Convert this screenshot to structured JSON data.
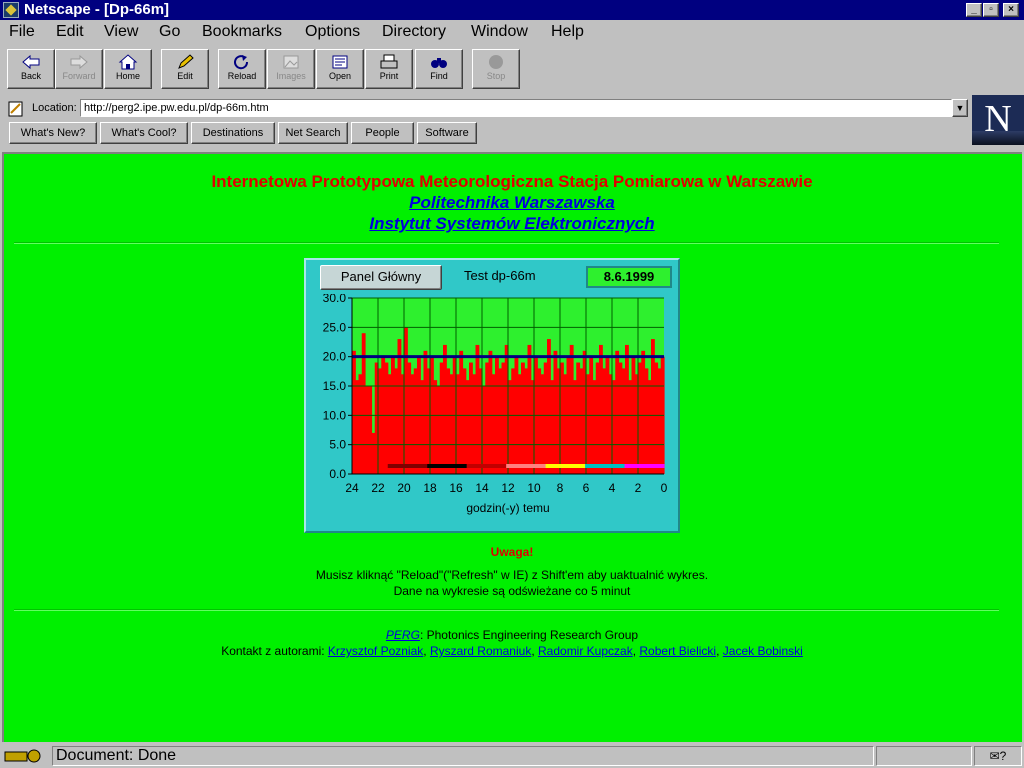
{
  "window": {
    "title": "Netscape - [Dp-66m]"
  },
  "menu": [
    "File",
    "Edit",
    "View",
    "Go",
    "Bookmarks",
    "Options",
    "Directory",
    "Window",
    "Help"
  ],
  "toolbar": {
    "back": "Back",
    "forward": "Forward",
    "home": "Home",
    "edit": "Edit",
    "reload": "Reload",
    "images": "Images",
    "open": "Open",
    "print": "Print",
    "find": "Find",
    "stop": "Stop"
  },
  "location": {
    "label": "Location:",
    "url": "http://perg2.ipe.pw.edu.pl/dp-66m.htm"
  },
  "directory_buttons": [
    "What's New?",
    "What's Cool?",
    "Destinations",
    "Net Search",
    "People",
    "Software"
  ],
  "logo": "N",
  "page": {
    "heading": "Internetowa Prototypowa Meteorologiczna Stacja Pomiarowa w Warszawie",
    "link1": "Politechnika Warszawska",
    "link2": "Instytut Systemów Elektronicznych",
    "applet": {
      "panel_button": "Panel Główny",
      "test_label": "Test dp-66m",
      "date": "8.6.1999"
    },
    "warning_title": "Uwaga!",
    "warning_line1": "Musisz kliknąć \"Reload\"(\"Refresh\" w IE) z Shift'em aby uaktualnić wykres.",
    "warning_line2": "Dane na wykresie są odświeżane co 5 minut",
    "perg_link": "PERG",
    "perg_text": ": Photonics Engineering Research Group",
    "contact_label": "Kontakt z autorami: ",
    "authors": [
      "Krzysztof Pozniak",
      "Ryszard Romaniuk",
      "Radomir Kupczak",
      "Robert Bielicki",
      "Jacek Bobinski"
    ]
  },
  "status": {
    "text": "Document: Done"
  },
  "colors": {
    "background": "#00f000",
    "heading": "#e00000",
    "link": "#0000dd",
    "bars": "#ff0000",
    "threshold": "#000080",
    "applet": "#30c8c8"
  },
  "chart_data": {
    "type": "bar",
    "xlabel": "godzin(-y) temu",
    "xticks": [
      "24",
      "22",
      "20",
      "18",
      "16",
      "14",
      "12",
      "10",
      "8",
      "6",
      "4",
      "2",
      "0"
    ],
    "yticks": [
      "30.0",
      "25.0",
      "20.0",
      "15.0",
      "10.0",
      "5.0",
      "0.0"
    ],
    "xlim": [
      24,
      0
    ],
    "ylim": [
      0,
      30
    ],
    "grid": true,
    "threshold": 20.0,
    "x": [
      23.875,
      23.625,
      23.375,
      23.125,
      22.875,
      22.625,
      22.375,
      22.125,
      21.875,
      21.625,
      21.375,
      21.125,
      20.875,
      20.625,
      20.375,
      20.125,
      19.875,
      19.625,
      19.375,
      19.125,
      18.875,
      18.625,
      18.375,
      18.125,
      17.875,
      17.625,
      17.375,
      17.125,
      16.875,
      16.625,
      16.375,
      16.125,
      15.875,
      15.625,
      15.375,
      15.125,
      14.875,
      14.625,
      14.375,
      14.125,
      13.875,
      13.625,
      13.375,
      13.125,
      12.875,
      12.625,
      12.375,
      12.125,
      11.875,
      11.625,
      11.375,
      11.125,
      10.875,
      10.625,
      10.375,
      10.125,
      9.875,
      9.625,
      9.375,
      9.125,
      8.875,
      8.625,
      8.375,
      8.125,
      7.875,
      7.625,
      7.375,
      7.125,
      6.875,
      6.625,
      6.375,
      6.125,
      5.875,
      5.625,
      5.375,
      5.125,
      4.875,
      4.625,
      4.375,
      4.125,
      3.875,
      3.625,
      3.375,
      3.125,
      2.875,
      2.625,
      2.375,
      2.125,
      1.875,
      1.625,
      1.375,
      1.125,
      0.875,
      0.625,
      0.375,
      0.125
    ],
    "values": [
      21,
      16,
      17,
      24,
      15,
      15,
      7,
      19,
      18,
      20,
      19,
      17,
      20,
      18,
      23,
      17,
      25,
      19,
      17,
      18,
      20,
      16,
      21,
      18,
      20,
      16,
      15,
      19,
      22,
      18,
      17,
      20,
      17,
      21,
      18,
      16,
      19,
      17,
      22,
      18,
      15,
      19,
      21,
      17,
      20,
      18,
      19,
      22,
      16,
      18,
      20,
      17,
      19,
      18,
      22,
      16,
      20,
      18,
      17,
      19,
      23,
      16,
      21,
      18,
      19,
      17,
      20,
      22,
      16,
      19,
      18,
      21,
      17,
      20,
      16,
      19,
      22,
      18,
      20,
      17,
      16,
      21,
      19,
      18,
      22,
      16,
      20,
      17,
      19,
      21,
      18,
      16,
      23,
      19,
      18,
      20
    ]
  }
}
